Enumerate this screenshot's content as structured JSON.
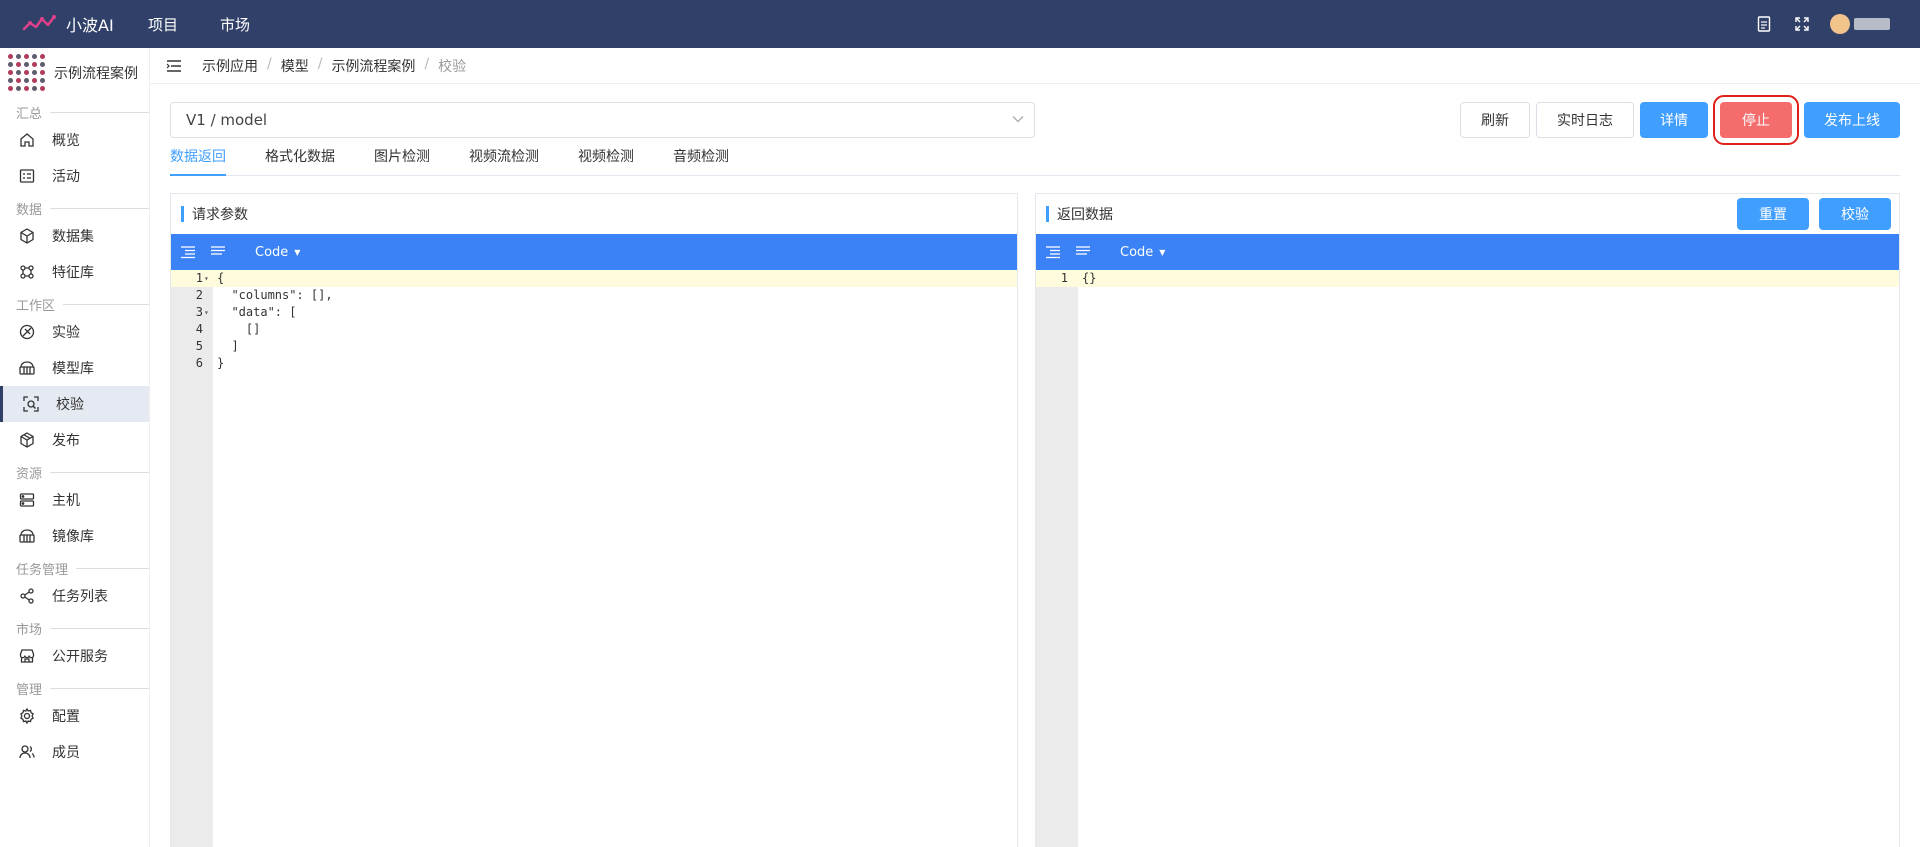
{
  "topbar": {
    "brand": "小波AI",
    "nav": [
      "项目",
      "市场"
    ],
    "colors": {
      "bg": "#304068",
      "accent": "#409eff"
    }
  },
  "sidebar": {
    "project_name": "示例流程案例",
    "groups": [
      {
        "title": "汇总",
        "items": [
          {
            "label": "概览",
            "icon": "home-icon"
          },
          {
            "label": "活动",
            "icon": "activity-icon"
          }
        ]
      },
      {
        "title": "数据",
        "items": [
          {
            "label": "数据集",
            "icon": "cube-icon"
          },
          {
            "label": "特征库",
            "icon": "feature-icon"
          }
        ]
      },
      {
        "title": "工作区",
        "items": [
          {
            "label": "实验",
            "icon": "experiment-icon"
          },
          {
            "label": "模型库",
            "icon": "model-icon"
          },
          {
            "label": "校验",
            "icon": "scan-icon",
            "active": true
          },
          {
            "label": "发布",
            "icon": "box-icon"
          }
        ]
      },
      {
        "title": "资源",
        "items": [
          {
            "label": "主机",
            "icon": "server-icon"
          },
          {
            "label": "镜像库",
            "icon": "image-icon"
          }
        ]
      },
      {
        "title": "任务管理",
        "items": [
          {
            "label": "任务列表",
            "icon": "share-icon"
          }
        ]
      },
      {
        "title": "市场",
        "items": [
          {
            "label": "公开服务",
            "icon": "store-icon"
          }
        ]
      },
      {
        "title": "管理",
        "items": [
          {
            "label": "配置",
            "icon": "gear-icon"
          },
          {
            "label": "成员",
            "icon": "users-icon"
          }
        ]
      }
    ]
  },
  "breadcrumb": [
    "示例应用",
    "模型",
    "示例流程案例",
    "校验"
  ],
  "toolbar": {
    "model_select": "V1 / model",
    "refresh": "刷新",
    "realtime_log": "实时日志",
    "details": "详情",
    "stop": "停止",
    "publish": "发布上线"
  },
  "tabs": [
    "数据返回",
    "格式化数据",
    "图片检测",
    "视频流检测",
    "视频检测",
    "音频检测"
  ],
  "active_tab": "数据返回",
  "request_panel": {
    "title": "请求参数",
    "mode": "Code",
    "lines": [
      "{",
      "  \"columns\": [],",
      "  \"data\": [",
      "    []",
      "  ]",
      "}"
    ],
    "foldable_lines": [
      1,
      3
    ]
  },
  "response_panel": {
    "title": "返回数据",
    "reset": "重置",
    "validate": "校验",
    "mode": "Code",
    "lines": [
      "{}"
    ]
  }
}
